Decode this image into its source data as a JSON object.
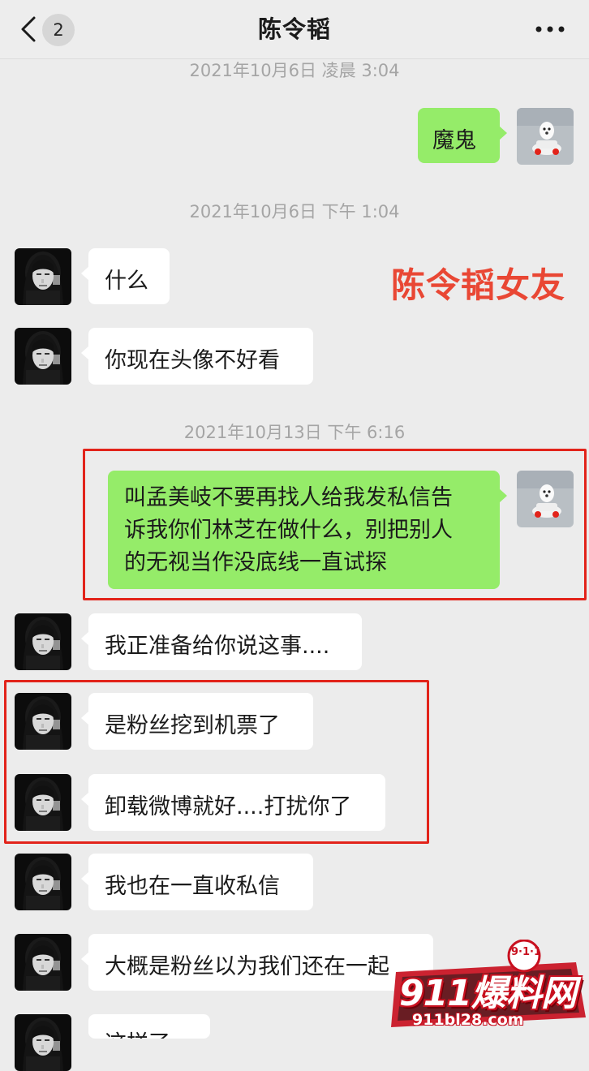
{
  "header": {
    "back_badge": "2",
    "title": "陈令韬"
  },
  "timestamps": [
    "2021年10月6日 凌晨 3:04",
    "2021年10月6日 下午 1:04",
    "2021年10月13日 下午 6:16"
  ],
  "messages": [
    {
      "side": "right",
      "text": "魔鬼"
    },
    {
      "side": "left",
      "text": "什么"
    },
    {
      "side": "left",
      "text": "你现在头像不好看"
    },
    {
      "side": "right",
      "text": "叫孟美岐不要再找人给我发私信告\n诉我你们林芝在做什么，别把别人\n的无视当作没底线一直试探"
    },
    {
      "side": "left",
      "text": "我正准备给你说这事...."
    },
    {
      "side": "left",
      "text": "是粉丝挖到机票了"
    },
    {
      "side": "left",
      "text": "卸载微博就好....打扰你了"
    },
    {
      "side": "left",
      "text": "我也在一直收私信"
    },
    {
      "side": "left",
      "text": "大概是粉丝以为我们还在一起"
    },
    {
      "side": "left",
      "text": "这样了"
    }
  ],
  "annotation": "陈令韬女友",
  "watermark": {
    "badge": "9·1·1",
    "name": "911爆料网",
    "url": "911bl28.com"
  },
  "colors": {
    "accent_red": "#e2231a",
    "bubble_green": "#95ec69",
    "bubble_white": "#ffffff",
    "background": "#ececec"
  }
}
